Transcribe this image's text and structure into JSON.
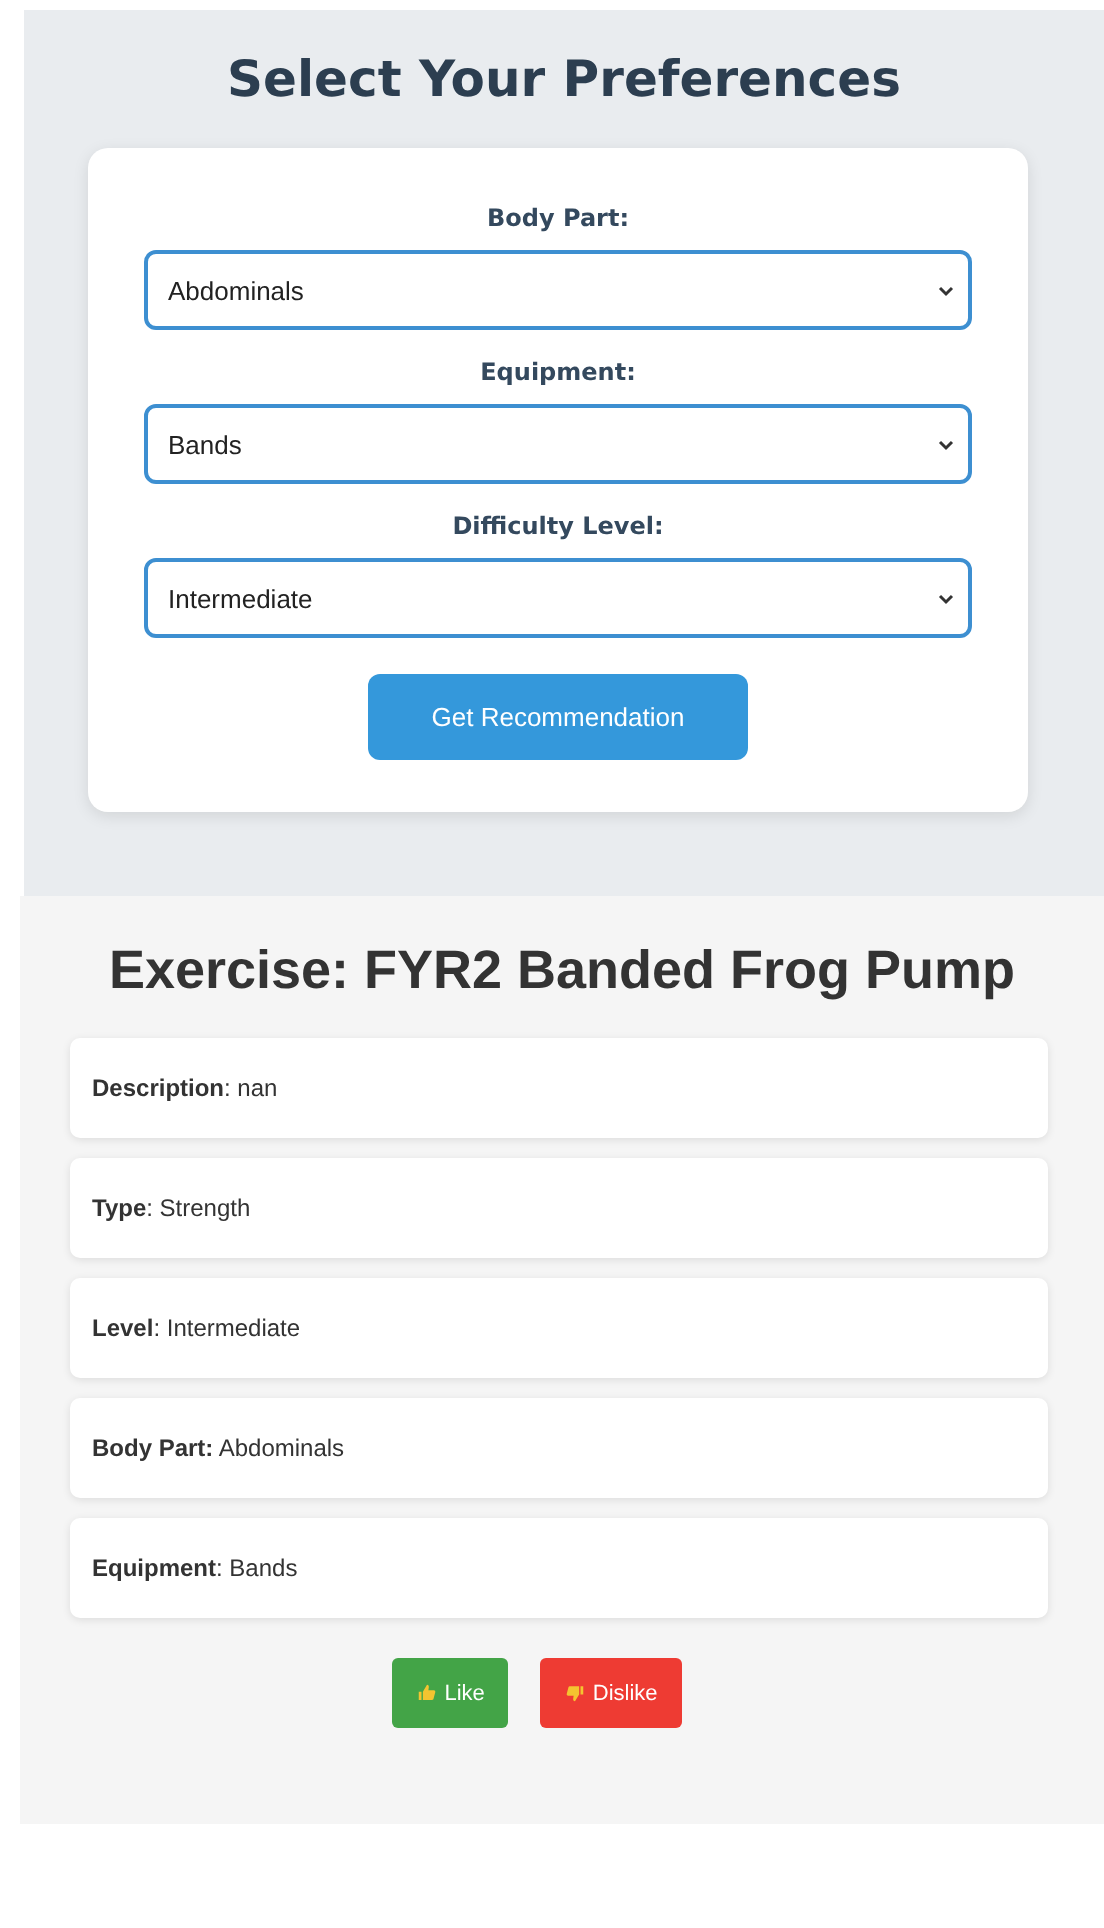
{
  "preferences": {
    "title": "Select Your Preferences",
    "fields": [
      {
        "label": "Body Part:",
        "value": "Abdominals"
      },
      {
        "label": "Equipment:",
        "value": "Bands"
      },
      {
        "label": "Difficulty Level:",
        "value": "Intermediate"
      }
    ],
    "button": "Get Recommendation"
  },
  "result": {
    "title": "Exercise: FYR2 Banded Frog Pump",
    "details": [
      "**Description**: nan",
      "**Type**: Strength",
      "**Level**: Intermediate",
      "**Body Part:** Abdominals",
      "**Equipment**: Bands"
    ],
    "actions": [
      {
        "kind": "like",
        "label": "Like"
      },
      {
        "kind": "dislike",
        "label": "Dislike"
      }
    ]
  }
}
